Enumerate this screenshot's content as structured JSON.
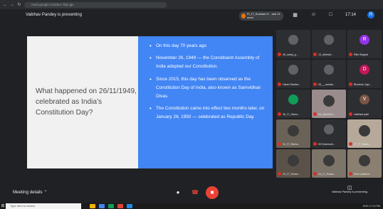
{
  "browser": {
    "url": "meet.google.com/aor-7fgv-gjv"
  },
  "topbar": {
    "presenter_text": "Vaibhav Pandey is presenting",
    "pinned_chip": "PI_IT_Sushant S... and 21 more",
    "clock": "17:14",
    "avatar_letter": "R"
  },
  "slide": {
    "question": "What happened on 26/11/1949, celebrated as India's Constitution Day?",
    "bullets": [
      "On this day 70 years ago",
      "November 26, 1949 — the Constituent Assembly of India adopted our Constitution.",
      "Since 2015, this day has been observed as the Constitution Day of India, also known as Samvidhan Divas.",
      "The Constitution came into effect two months later, on January 26, 1950 — celebrated as Republic Day."
    ]
  },
  "participants": [
    {
      "name": "45_sairaj_g...",
      "initial": "",
      "video": false
    },
    {
      "name": "13_Abhisht...",
      "initial": "",
      "video": false
    },
    {
      "name": "Ritik Singhal",
      "initial": "R",
      "video": false
    },
    {
      "name": "Harsh Samba...",
      "initial": "",
      "video": false
    },
    {
      "name": "26___sankal...",
      "initial": "",
      "video": false
    },
    {
      "name": "Bhushan Jaju...",
      "initial": "D",
      "video": false
    },
    {
      "name": "30_IT_Gamo...",
      "initial": "",
      "video": false
    },
    {
      "name": "04_AyushGa...",
      "initial": "",
      "video": true
    },
    {
      "name": "vaibhavi patil",
      "initial": "V",
      "video": false
    },
    {
      "name": "31_IT_Simha...",
      "initial": "",
      "video": true
    },
    {
      "name": "09 Dharmodi...",
      "initial": "",
      "video": false
    },
    {
      "name": "27_IT_Saksh...",
      "initial": "",
      "video": true
    },
    {
      "name": "23_IT_Sohan...",
      "initial": "",
      "video": true
    },
    {
      "name": "24_IT_Suhas...",
      "initial": "",
      "video": true
    },
    {
      "name": "Sree Lakshmi...",
      "initial": "",
      "video": true
    }
  ],
  "bottombar": {
    "meeting_details": "Meeting details",
    "present_label": "Vaibhav Pandey is presenting"
  },
  "taskbar": {
    "search_placeholder": "Type here to search",
    "tray": "ENG 17:14 PM"
  },
  "colors": {
    "slide_blue": "#4285f4",
    "end_call": "#ea4335"
  }
}
